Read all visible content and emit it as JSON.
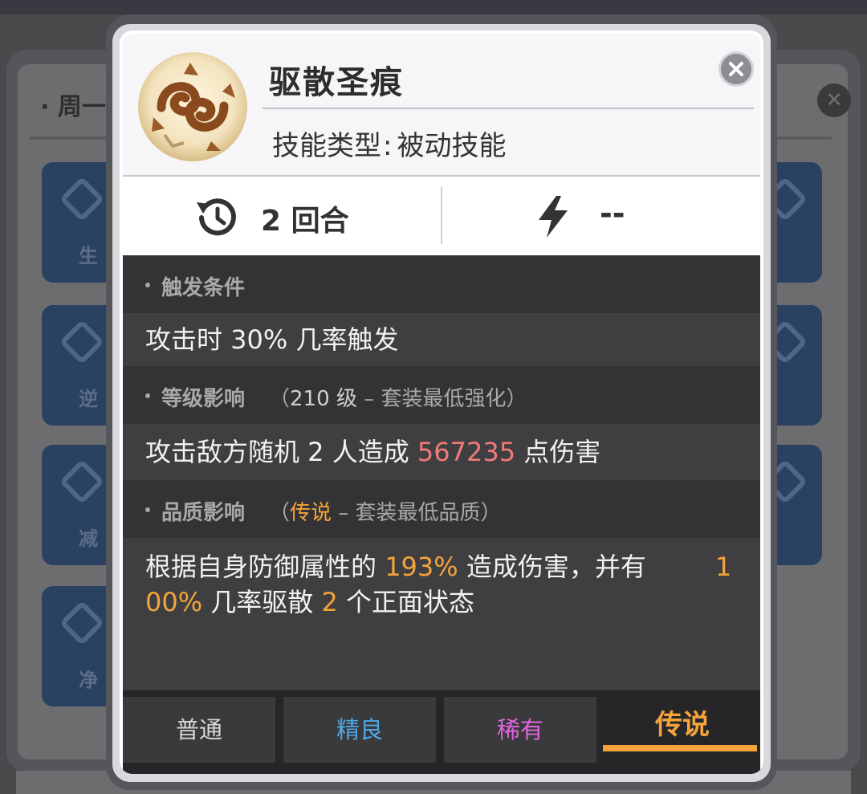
{
  "background": {
    "header_text": "· 周一",
    "close_symbol": "✕",
    "tile_labels": [
      "生",
      "逆",
      "减",
      "净"
    ]
  },
  "skill": {
    "name": "驱散圣痕",
    "type_label": "技能类型",
    "type_separator": ":",
    "type_value": "被动技能",
    "icon": "holy-scroll-swirl-icon",
    "icon_colors": {
      "base": "#f3e3bf",
      "swirl": "#8a4a1e"
    }
  },
  "close": {
    "icon": "close-icon"
  },
  "stats": {
    "cooldown_icon": "cooldown-clock-icon",
    "cooldown": "2 回合",
    "energy_icon": "lightning-bolt-icon",
    "energy": "--"
  },
  "sections": {
    "trigger": {
      "title": "触发条件",
      "text": "攻击时 30% 几率触发"
    },
    "level": {
      "title": "等级影响",
      "sub_open": "（",
      "sub_value": "210 级",
      "sub_rest": " – 套装最低强化）",
      "text_before": "攻击敌方随机 2 人造成 ",
      "damage": "567235",
      "text_after": " 点伤害"
    },
    "quality": {
      "title": "品质影响",
      "sub_open": "（",
      "sub_value": "传说",
      "sub_rest": " – 套装最低品质）",
      "line1_before": "根据自身防御属性的 ",
      "percent": "193%",
      "line1_mid": " 造成伤害，并有 ",
      "chance_part1": "1",
      "chance_part2": "00%",
      "line2_mid": " 几率驱散 ",
      "count": "2",
      "line2_after": " 个正面状态"
    }
  },
  "tabs": [
    {
      "label": "普通",
      "color": "#d8d8d8",
      "active": false
    },
    {
      "label": "精良",
      "color": "#4fa8e8",
      "active": false
    },
    {
      "label": "稀有",
      "color": "#e066e0",
      "active": false
    },
    {
      "label": "传说",
      "color": "#f4a43a",
      "active": true
    }
  ],
  "colors": {
    "highlight_damage": "#f07a7a",
    "highlight_quality": "#f4a43a",
    "panel_dark": "#3f3f41",
    "section_header": "#333335"
  }
}
